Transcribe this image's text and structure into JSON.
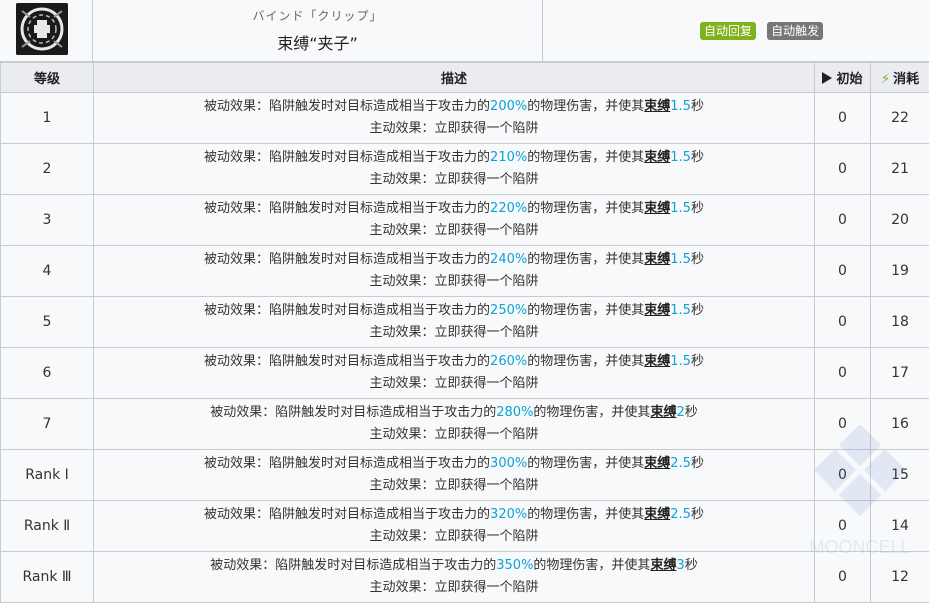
{
  "skill": {
    "subtitle": "バインド「クリップ」",
    "name": "束缚“夹子”",
    "icon": "trap-clip-icon",
    "tags": [
      "自动回复",
      "自动触发"
    ]
  },
  "colors": {
    "highlight": "#0ea2d6",
    "tag_green": "#7fb21a",
    "tag_gray": "#777777"
  },
  "table": {
    "headers": {
      "level": "等级",
      "desc": "描述",
      "init": "初始",
      "cost": "消耗"
    },
    "rows": [
      {
        "level": "1",
        "p1": "被动效果：陷阱触发时对目标造成相当于攻击力的",
        "pct": "200%",
        "p2": "的物理伤害，并使其",
        "kw": "束缚",
        "dur": "1.5",
        "unit": "秒",
        "active": "主动效果：立即获得一个陷阱",
        "init": "0",
        "cost": "22"
      },
      {
        "level": "2",
        "p1": "被动效果：陷阱触发时对目标造成相当于攻击力的",
        "pct": "210%",
        "p2": "的物理伤害，并使其",
        "kw": "束缚",
        "dur": "1.5",
        "unit": "秒",
        "active": "主动效果：立即获得一个陷阱",
        "init": "0",
        "cost": "21"
      },
      {
        "level": "3",
        "p1": "被动效果：陷阱触发时对目标造成相当于攻击力的",
        "pct": "220%",
        "p2": "的物理伤害，并使其",
        "kw": "束缚",
        "dur": "1.5",
        "unit": "秒",
        "active": "主动效果：立即获得一个陷阱",
        "init": "0",
        "cost": "20"
      },
      {
        "level": "4",
        "p1": "被动效果：陷阱触发时对目标造成相当于攻击力的",
        "pct": "240%",
        "p2": "的物理伤害，并使其",
        "kw": "束缚",
        "dur": "1.5",
        "unit": "秒",
        "active": "主动效果：立即获得一个陷阱",
        "init": "0",
        "cost": "19"
      },
      {
        "level": "5",
        "p1": "被动效果：陷阱触发时对目标造成相当于攻击力的",
        "pct": "250%",
        "p2": "的物理伤害，并使其",
        "kw": "束缚",
        "dur": "1.5",
        "unit": "秒",
        "active": "主动效果：立即获得一个陷阱",
        "init": "0",
        "cost": "18"
      },
      {
        "level": "6",
        "p1": "被动效果：陷阱触发时对目标造成相当于攻击力的",
        "pct": "260%",
        "p2": "的物理伤害，并使其",
        "kw": "束缚",
        "dur": "1.5",
        "unit": "秒",
        "active": "主动效果：立即获得一个陷阱",
        "init": "0",
        "cost": "17"
      },
      {
        "level": "7",
        "p1": "被动效果：陷阱触发时对目标造成相当于攻击力的",
        "pct": "280%",
        "p2": "的物理伤害，并使其",
        "kw": "束缚",
        "dur": "2",
        "unit": "秒",
        "active": "主动效果：立即获得一个陷阱",
        "init": "0",
        "cost": "16"
      },
      {
        "level": "Rank Ⅰ",
        "p1": "被动效果：陷阱触发时对目标造成相当于攻击力的",
        "pct": "300%",
        "p2": "的物理伤害，并使其",
        "kw": "束缚",
        "dur": "2.5",
        "unit": "秒",
        "active": "主动效果：立即获得一个陷阱",
        "init": "0",
        "cost": "15"
      },
      {
        "level": "Rank Ⅱ",
        "p1": "被动效果：陷阱触发时对目标造成相当于攻击力的",
        "pct": "320%",
        "p2": "的物理伤害，并使其",
        "kw": "束缚",
        "dur": "2.5",
        "unit": "秒",
        "active": "主动效果：立即获得一个陷阱",
        "init": "0",
        "cost": "14"
      },
      {
        "level": "Rank Ⅲ",
        "p1": "被动效果：陷阱触发时对目标造成相当于攻击力的",
        "pct": "350%",
        "p2": "的物理伤害，并使其",
        "kw": "束缚",
        "dur": "3",
        "unit": "秒",
        "active": "主动效果：立即获得一个陷阱",
        "init": "0",
        "cost": "12"
      }
    ]
  },
  "watermark": "MOONCELL"
}
